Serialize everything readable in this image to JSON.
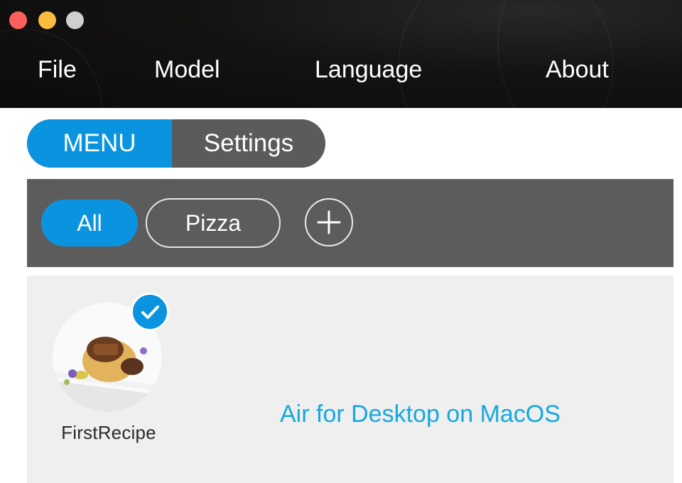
{
  "window": {
    "controls": {
      "close_color": "#fc605c",
      "minimize_color": "#fdbc40",
      "zoom_color": "#cfcfcf"
    }
  },
  "menubar": {
    "items": [
      {
        "label": "File"
      },
      {
        "label": "Model"
      },
      {
        "label": "Language"
      },
      {
        "label": "About"
      }
    ]
  },
  "segmented": {
    "menu_label": "MENU",
    "settings_label": "Settings",
    "selected": "MENU",
    "accent_color": "#0a94e0"
  },
  "categories": {
    "chips": [
      {
        "label": "All",
        "selected": true
      },
      {
        "label": "Pizza",
        "selected": false
      }
    ],
    "add_icon": "plus-circle-icon"
  },
  "recipes": [
    {
      "name": "FirstRecipe",
      "selected": true,
      "badge_icon": "checkmark-icon",
      "image": "plated-dish-photo"
    }
  ],
  "footer": {
    "text": "Air for Desktop on MacOS",
    "color": "#16a8de"
  }
}
